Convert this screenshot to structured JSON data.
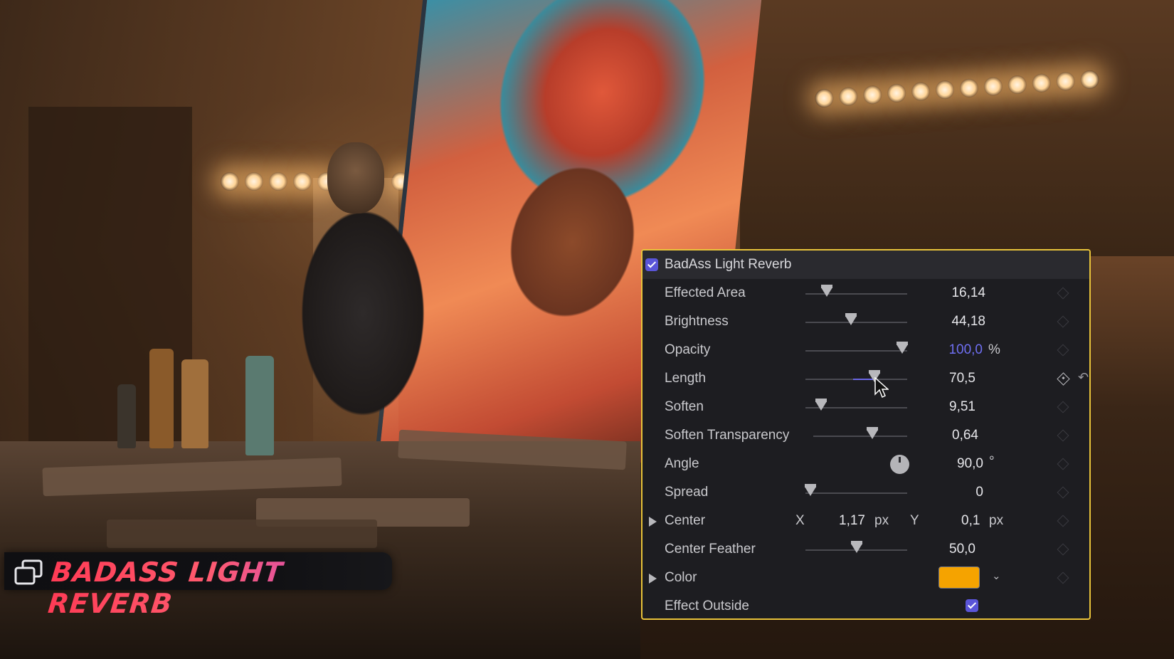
{
  "badge": {
    "title": "BADASS LIGHT REVERB",
    "icon": "layers-icon"
  },
  "effect": {
    "name": "BadAss Light Reverb",
    "enabled": true,
    "accent": "#5a55d8",
    "border_color": "#e8c33a"
  },
  "params": {
    "effected_area": {
      "label": "Effected Area",
      "value": "16,14",
      "level": 0.18
    },
    "brightness": {
      "label": "Brightness",
      "value": "44,18",
      "level": 0.44
    },
    "opacity": {
      "label": "Opacity",
      "value": "100,0",
      "unit": "%",
      "level": 1.0
    },
    "length": {
      "label": "Length",
      "value": "70,5",
      "level": 0.7
    },
    "soften": {
      "label": "Soften",
      "value": "9,51",
      "level": 0.12
    },
    "soften_transparency": {
      "label": "Soften Transparency",
      "value": "0,64",
      "level": 0.64
    },
    "angle": {
      "label": "Angle",
      "value": "90,0",
      "unit": "°"
    },
    "spread": {
      "label": "Spread",
      "value": "0",
      "level": 0.0
    },
    "center": {
      "label": "Center",
      "x_label": "X",
      "x_value": "1,17",
      "x_unit": "px",
      "y_label": "Y",
      "y_value": "0,1",
      "y_unit": "px"
    },
    "center_feather": {
      "label": "Center Feather",
      "value": "50,0",
      "level": 0.5
    },
    "color": {
      "label": "Color",
      "swatch": "#f5a300"
    },
    "effect_outside": {
      "label": "Effect Outside",
      "checked": true
    }
  }
}
